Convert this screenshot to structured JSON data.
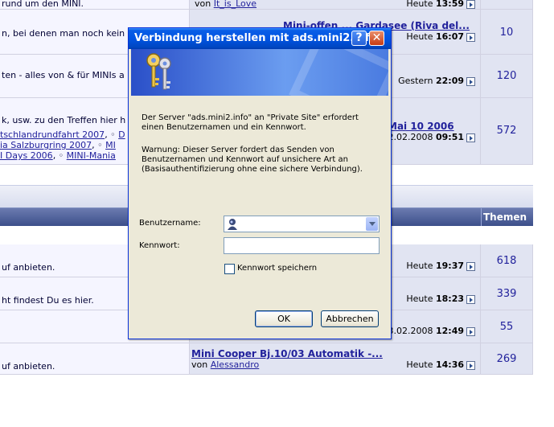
{
  "forum": {
    "rows": [
      {
        "desc1": "rund um den MINI.",
        "last_by_prefix": "von",
        "last_by_user": "It_is_Love",
        "last_date": "Heute",
        "last_time": "13:59",
        "count": ""
      },
      {
        "desc1": "n, bei denen man noch kein",
        "last_title": "Mini-offen ... Gardasee (Riva del...",
        "last_date": "Heute",
        "last_time": "16:07",
        "count": "10"
      },
      {
        "desc1": "ten - alles von & für MINIs a",
        "last_date": "Gestern",
        "last_time": "22:09",
        "count": "120"
      },
      {
        "desc1": "k, usw. zu den Treffen hier h",
        "sub1": "tschlandrundfahrt 2007",
        "sub2": "D",
        "sub3": "ia Salzburgring 2007",
        "sub4": "MI",
        "sub5": "I Days 2006",
        "sub6": "MINI-Mania",
        "last_title": "Mai 10 2006",
        "last_date": "2.02.2008",
        "last_time": "09:51",
        "count": "572"
      }
    ],
    "header_col": "Themen",
    "rows2": [
      {
        "desc1": "uf anbieten.",
        "last_date": "Heute",
        "last_time": "19:37",
        "count": "618"
      },
      {
        "desc1": "ht findest Du es hier.",
        "last_date": "Heute",
        "last_time": "18:23",
        "count": "339"
      },
      {
        "desc1": "",
        "last_date": "3.02.2008",
        "last_time": "12:49",
        "count": "55"
      },
      {
        "desc1": "uf anbieten.",
        "last_title": "Mini Cooper Bj.10/03 Automatik -...",
        "last_by_prefix": "von",
        "last_by_user": "Alessandro",
        "last_date": "Heute",
        "last_time": "14:36",
        "count": "269"
      }
    ]
  },
  "dialog": {
    "title": "Verbindung herstellen mit ads.mini2.info",
    "help_label": "?",
    "close_label": "✕",
    "message": "Der Server \"ads.mini2.info\" an \"Private Site\" erfordert einen Benutzernamen und ein Kennwort.",
    "warning": "Warnung: Dieser Server fordert das Senden von Benutzernamen und Kennwort auf unsichere Art an (Basisauthentifizierung ohne eine sichere Verbindung).",
    "username_label": "Benutzername:",
    "username_value": "",
    "password_label": "Kennwort:",
    "password_value": "",
    "remember_label": "Kennwort speichern",
    "remember_checked": false,
    "ok_label": "OK",
    "cancel_label": "Abbrechen"
  }
}
